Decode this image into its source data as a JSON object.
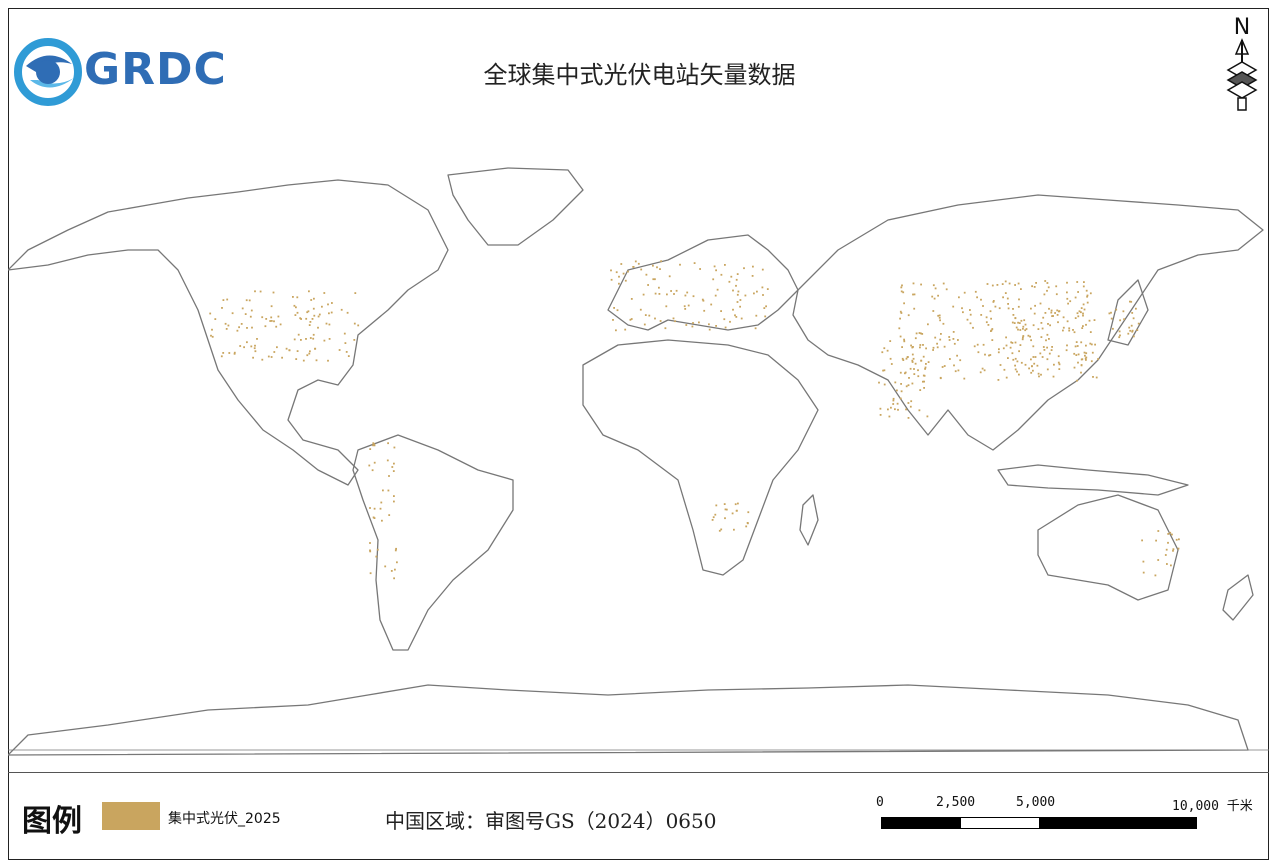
{
  "logo": {
    "text": "GRDC"
  },
  "title": "全球集中式光伏电站矢量数据",
  "north_arrow": {
    "label": "N"
  },
  "legend": {
    "title": "图例",
    "items": [
      {
        "label": "集中式光伏_2025",
        "color": "#c9a55f"
      }
    ]
  },
  "approval_text": "中国区域：审图号GS（2024）0650",
  "scale_bar": {
    "ticks": [
      "0",
      "2,500",
      "5,000",
      "10,000 千米"
    ]
  },
  "colors": {
    "coastline": "#777777",
    "pv": "#c9a55f",
    "logo": "#2f6db5"
  }
}
